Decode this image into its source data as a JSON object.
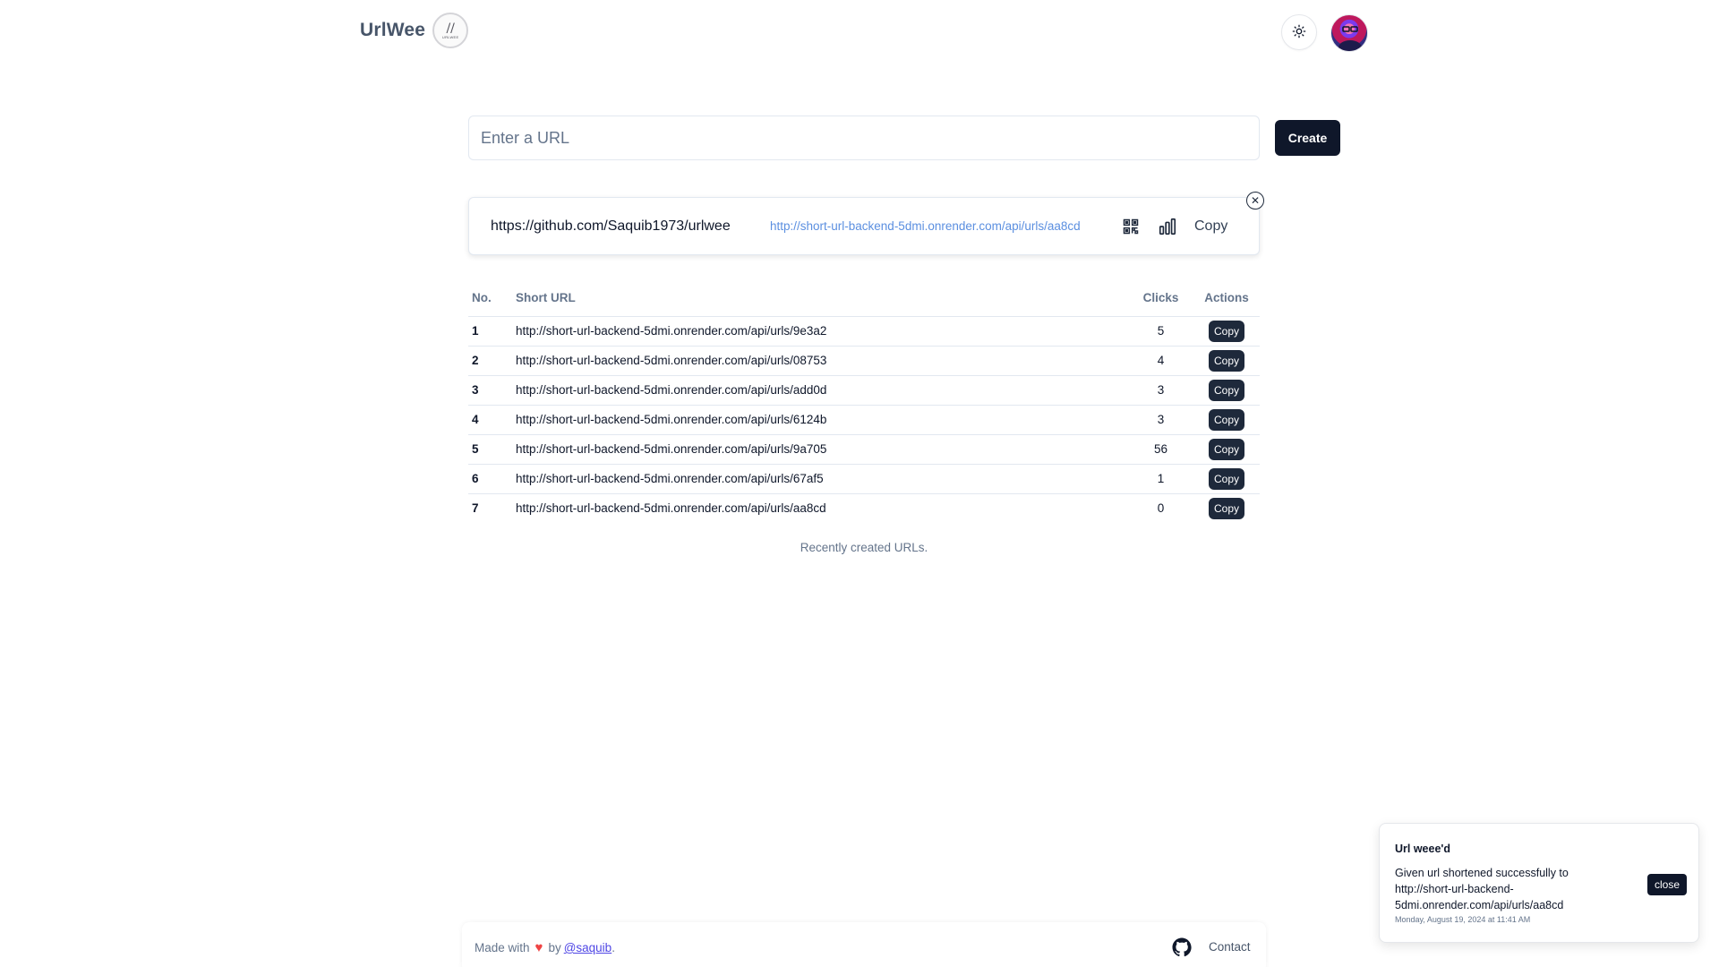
{
  "header": {
    "brand_name": "UrlWee",
    "logo_mark": "//",
    "logo_text": "URLWEE",
    "theme_icon": "sun-icon",
    "avatar_icon": "avatar"
  },
  "form": {
    "placeholder": "Enter a URL",
    "value": "",
    "create_label": "Create"
  },
  "result": {
    "original_url": "https://github.com/Saquib1973/urlwee",
    "short_url": "http://short-url-backend-5dmi.onrender.com/api/urls/aa8cd",
    "qr_icon": "qr-code-icon",
    "stats_icon": "bar-chart-icon",
    "copy_label": "Copy",
    "close_icon": "close-circle-icon"
  },
  "table": {
    "headers": {
      "no": "No.",
      "short_url": "Short URL",
      "clicks": "Clicks",
      "actions": "Actions"
    },
    "rows": [
      {
        "no": "1",
        "url": "http://short-url-backend-5dmi.onrender.com/api/urls/9e3a2",
        "clicks": "5",
        "action": "Copy"
      },
      {
        "no": "2",
        "url": "http://short-url-backend-5dmi.onrender.com/api/urls/08753",
        "clicks": "4",
        "action": "Copy"
      },
      {
        "no": "3",
        "url": "http://short-url-backend-5dmi.onrender.com/api/urls/add0d",
        "clicks": "3",
        "action": "Copy"
      },
      {
        "no": "4",
        "url": "http://short-url-backend-5dmi.onrender.com/api/urls/6124b",
        "clicks": "3",
        "action": "Copy"
      },
      {
        "no": "5",
        "url": "http://short-url-backend-5dmi.onrender.com/api/urls/9a705",
        "clicks": "56",
        "action": "Copy"
      },
      {
        "no": "6",
        "url": "http://short-url-backend-5dmi.onrender.com/api/urls/67af5",
        "clicks": "1",
        "action": "Copy"
      },
      {
        "no": "7",
        "url": "http://short-url-backend-5dmi.onrender.com/api/urls/aa8cd",
        "clicks": "0",
        "action": "Copy"
      }
    ],
    "caption": "Recently created URLs."
  },
  "footer": {
    "made_with": "Made with",
    "heart": "♥",
    "by": "by",
    "author_link": "@saquib",
    "period": ".",
    "github_icon": "github-icon",
    "contact_label": "Contact"
  },
  "toast": {
    "title": "Url weee'd",
    "message": "Given url shortened successfully to http://short-url-backend-5dmi.onrender.com/api/urls/aa8cd",
    "time": "Monday, August 19, 2024 at 11:41 AM",
    "close_label": "close"
  },
  "colors": {
    "primary": "#0f172a",
    "link": "#5b8fe0",
    "muted": "#64748b",
    "heart": "#ef4444"
  }
}
